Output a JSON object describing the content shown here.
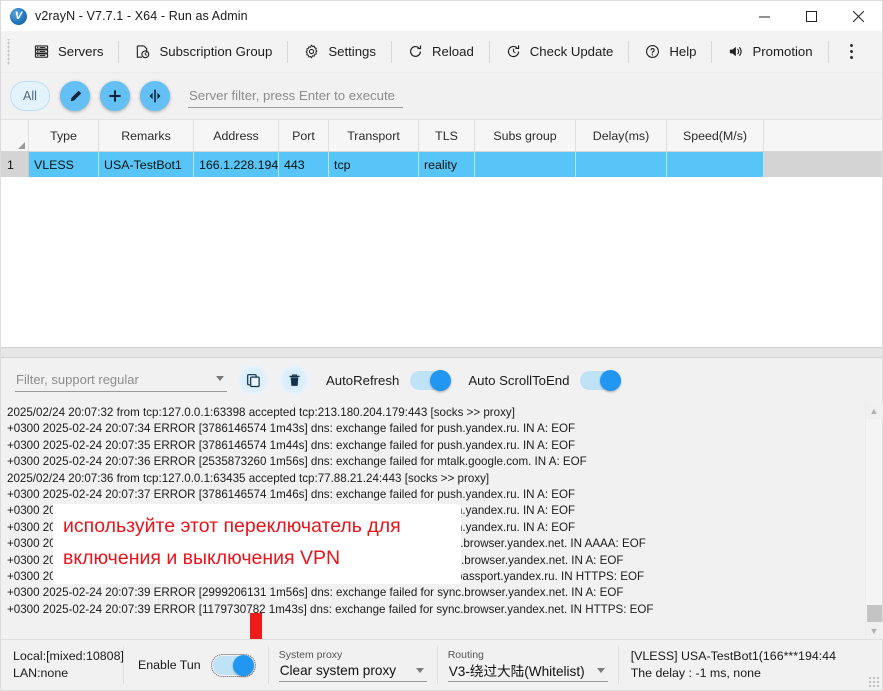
{
  "window": {
    "title": "v2rayN - V7.7.1 - X64 - Run as Admin",
    "app_icon": "v2rayn-logo-icon",
    "minimize_label": "–",
    "maximize_label": "□",
    "close_label": "✕"
  },
  "toolbar": {
    "items": [
      {
        "label": "Servers",
        "icon": "servers-icon"
      },
      {
        "label": "Subscription Group",
        "icon": "subscription-group-icon"
      },
      {
        "label": "Settings",
        "icon": "gear-icon"
      },
      {
        "label": "Reload",
        "icon": "reload-icon"
      },
      {
        "label": "Check Update",
        "icon": "check-update-icon"
      },
      {
        "label": "Help",
        "icon": "help-icon"
      },
      {
        "label": "Promotion",
        "icon": "speaker-icon"
      }
    ],
    "more_icon": "more-vertical-icon"
  },
  "filter_row": {
    "all_chip": "All",
    "edit_icon": "pencil-icon",
    "add_icon": "plus-icon",
    "adjust_icon": "sliders-icon",
    "search_placeholder": "Server filter, press Enter to execute",
    "search_value": ""
  },
  "server_table": {
    "columns": [
      "Type",
      "Remarks",
      "Address",
      "Port",
      "Transport",
      "TLS",
      "Subs group",
      "Delay(ms)",
      "Speed(M/s)"
    ],
    "rows": [
      {
        "index": "1",
        "type": "VLESS",
        "remarks": "USA-TestBot1",
        "address": "166.1.228.194",
        "port": "443",
        "transport": "tcp",
        "tls": "reality",
        "subs_group": "",
        "delay": "",
        "speed": "",
        "selected": true
      }
    ],
    "selection_color": "#57c5f7"
  },
  "log_toolbar": {
    "filter_placeholder": "Filter, support regular",
    "filter_value": "",
    "copy_icon": "copy-icon",
    "delete_icon": "trash-icon",
    "auto_refresh_label": "AutoRefresh",
    "auto_refresh_on": true,
    "auto_scroll_label": "Auto ScrollToEnd",
    "auto_scroll_on": true
  },
  "log": {
    "lines": [
      "2025/02/24 20:07:32 from tcp:127.0.0.1:63398 accepted tcp:213.180.204.179:443 [socks >> proxy]",
      "+0300 2025-02-24 20:07:34 ERROR [3786146574 1m43s] dns: exchange failed for push.yandex.ru. IN A: EOF",
      "+0300 2025-02-24 20:07:35 ERROR [3786146574 1m44s] dns: exchange failed for push.yandex.ru. IN A: EOF",
      "+0300 2025-02-24 20:07:36 ERROR [2535873260 1m56s] dns: exchange failed for mtalk.google.com. IN A: EOF",
      "2025/02/24 20:07:36 from tcp:127.0.0.1:63435 accepted tcp:77.88.21.24:443 [socks >> proxy]",
      "+0300 2025-02-24 20:07:37 ERROR [3786146574 1m46s] dns: exchange failed for push.yandex.ru. IN A: EOF",
      "+0300 2025-02-24 20:07:37 ERROR [3786146574 1m46s] dns: exchange failed for push.yandex.ru. IN A: EOF",
      "+0300 2025-02-24 20:07:38 ERROR [3786146574 1m47s] dns: exchange failed for push.yandex.ru. IN A: EOF",
      "+0300 2025-02-24 20:07:38 ERROR [1179730782 1m42s] dns: exchange failed for sync.browser.yandex.net. IN AAAA: EOF",
      "+0300 2025-02-24 20:07:38 ERROR [2999206131 1m55s] dns: exchange failed for sync.browser.yandex.net. IN A: EOF",
      "+0300 2025-02-24 20:07:39 ERROR [1090279126 1m57s] dns: exchange failed for api.passport.yandex.ru. IN HTTPS: EOF",
      "+0300 2025-02-24 20:07:39 ERROR [2999206131 1m56s] dns: exchange failed for sync.browser.yandex.net. IN A: EOF",
      "+0300 2025-02-24 20:07:39 ERROR [1179730782 1m43s] dns: exchange failed for sync.browser.yandex.net. IN HTTPS: EOF"
    ],
    "scroll_up_icon": "arrow-up-icon",
    "scroll_down_icon": "arrow-down-icon"
  },
  "annotation": {
    "line1": "используйте этот переключатель для",
    "line2": "включения и выключения VPN",
    "color": "#e8141c",
    "arrow_icon": "red-down-arrow-icon"
  },
  "status_bar": {
    "local": "Local:[mixed:10808]",
    "lan": "LAN:none",
    "enable_tun_label": "Enable Tun",
    "enable_tun_on": true,
    "system_proxy_caption": "System proxy",
    "system_proxy_value": "Clear system proxy",
    "routing_caption": "Routing",
    "routing_value": "V3-绕过大陆(Whitelist)",
    "connection": "[VLESS] USA-TestBot1(166***194:44",
    "delay": "The delay : -1 ms, none"
  }
}
